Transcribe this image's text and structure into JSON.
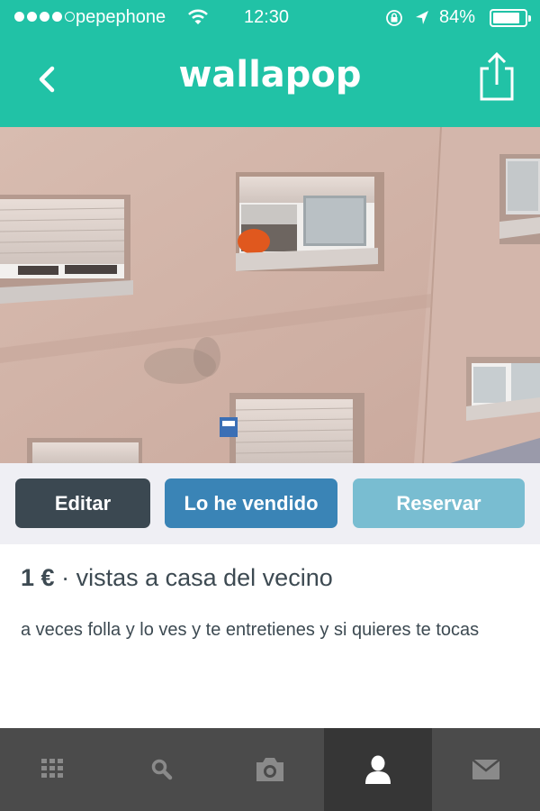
{
  "status_bar": {
    "carrier": "pepephone",
    "time": "12:30",
    "battery_percent": "84%",
    "battery_level": 0.84,
    "signal_bars": 4
  },
  "nav": {
    "back_icon": "chevron-left-icon",
    "logo_text": "wallapop",
    "share_icon": "share-icon"
  },
  "actions": {
    "edit_label": "Editar",
    "sold_label": "Lo he vendido",
    "reserve_label": "Reservar"
  },
  "item": {
    "price": "1 €",
    "separator": "·",
    "title": "vistas a casa del vecino",
    "description": "a veces folla y lo ves y te entretienes y si quieres te tocas"
  },
  "tabbar": {
    "tabs": [
      {
        "icon": "grid-icon",
        "active": false
      },
      {
        "icon": "search-icon",
        "active": false
      },
      {
        "icon": "camera-icon",
        "active": false
      },
      {
        "icon": "profile-icon",
        "active": true
      },
      {
        "icon": "mail-icon",
        "active": false
      }
    ]
  },
  "colors": {
    "brand_teal": "#21c2a6",
    "edit_button": "#3b4851",
    "sold_button": "#3a84b6",
    "reserve_button": "#79bdd1",
    "tabbar": "#4b4b4b",
    "tab_active": "#363636"
  }
}
